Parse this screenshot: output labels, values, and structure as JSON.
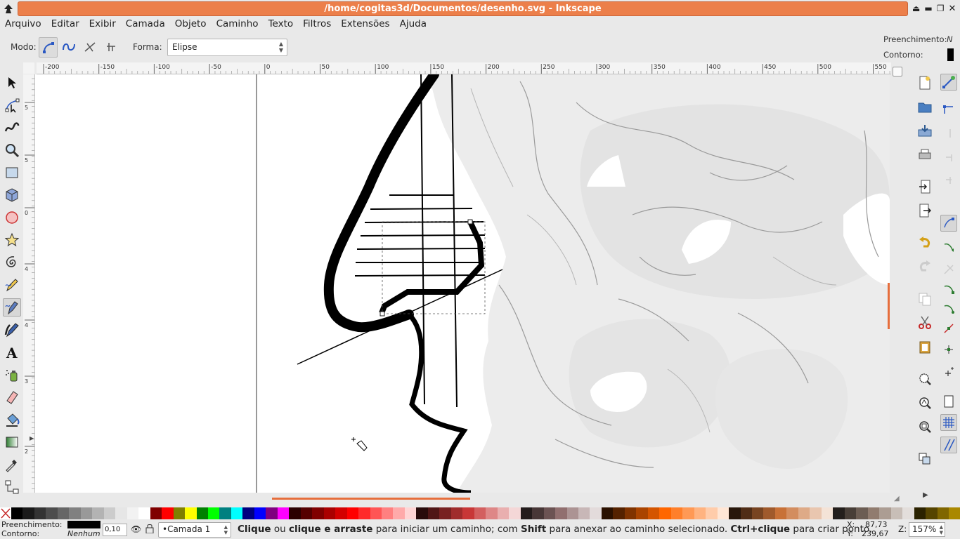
{
  "window": {
    "title": "/home/cogitas3d/Documentos/desenho.svg - Inkscape"
  },
  "menu": [
    "Arquivo",
    "Editar",
    "Exibir",
    "Camada",
    "Objeto",
    "Caminho",
    "Texto",
    "Filtros",
    "Extensões",
    "Ajuda"
  ],
  "toolbar": {
    "mode_label": "Modo:",
    "shape_label": "Forma:",
    "shape_value": "Elipse",
    "fill_label": "Preenchimento:",
    "fill_value": "N",
    "stroke_label": "Contorno:"
  },
  "ruler": {
    "h_ticks": [
      "-200",
      "-150",
      "-100",
      "-50",
      "0",
      "50",
      "100",
      "150",
      "200",
      "250",
      "300",
      "350",
      "400",
      "450",
      "500",
      "550"
    ],
    "v_ticks": [
      "5",
      "5",
      "0",
      "4",
      "4",
      "3",
      "2"
    ]
  },
  "palette": [
    "#000000",
    "#1a1a1a",
    "#333333",
    "#4d4d4d",
    "#666666",
    "#808080",
    "#999999",
    "#b3b3b3",
    "#cccccc",
    "#e6e6e6",
    "#f2f2f2",
    "#ffffff",
    "#800000",
    "#ff0000",
    "#808000",
    "#ffff00",
    "#008000",
    "#00ff00",
    "#008080",
    "#00ffff",
    "#000080",
    "#0000ff",
    "#800080",
    "#ff00ff",
    "#2b0000",
    "#550000",
    "#800000",
    "#aa0000",
    "#d40000",
    "#ff0000",
    "#ff2a2a",
    "#ff5555",
    "#ff8080",
    "#ffaaaa",
    "#ffd5d5",
    "#280b0b",
    "#501616",
    "#782121",
    "#a02c2c",
    "#c83737",
    "#d35f5f",
    "#de8787",
    "#e9afaf",
    "#f4d7d7",
    "#241c1c",
    "#483737",
    "#6c5353",
    "#916f6f",
    "#ac9393",
    "#c8b7b7",
    "#e3dbdb",
    "#2b1100",
    "#552200",
    "#803300",
    "#aa4400",
    "#d45500",
    "#ff6600",
    "#ff7f2a",
    "#ff9955",
    "#ffb380",
    "#ffccaa",
    "#ffe6d5",
    "#28170b",
    "#502d16",
    "#784421",
    "#a05a2c",
    "#c87137",
    "#d38d5f",
    "#deaa87",
    "#e9c6af",
    "#f4e3d7",
    "#241f1c",
    "#483e37",
    "#6c5d53",
    "#917c6f",
    "#ac9d93",
    "#c8beb7",
    "#e3dedb",
    "#2b2200",
    "#554400",
    "#806600",
    "#aa8800"
  ],
  "status": {
    "fill_label": "Preenchimento:",
    "stroke_label": "Contorno:",
    "stroke_value": "Nenhum",
    "opacity_value": "0,10",
    "layer": "•Camada 1",
    "message_parts": [
      "Clique",
      " ou ",
      "clique e arraste",
      " para iniciar um caminho; com ",
      "Shift",
      " para anexar ao caminho selecionado. ",
      "Ctrl+clique",
      " para criar ponto."
    ],
    "x_label": "X:",
    "x_value": "87,73",
    "y_label": "Y:",
    "y_value": "239,67",
    "z_label": "Z:",
    "zoom": "157%"
  },
  "colors": {
    "title_accent": "#ec7f4a",
    "canvas": "#ffffff",
    "guide": "#e66e3c"
  }
}
